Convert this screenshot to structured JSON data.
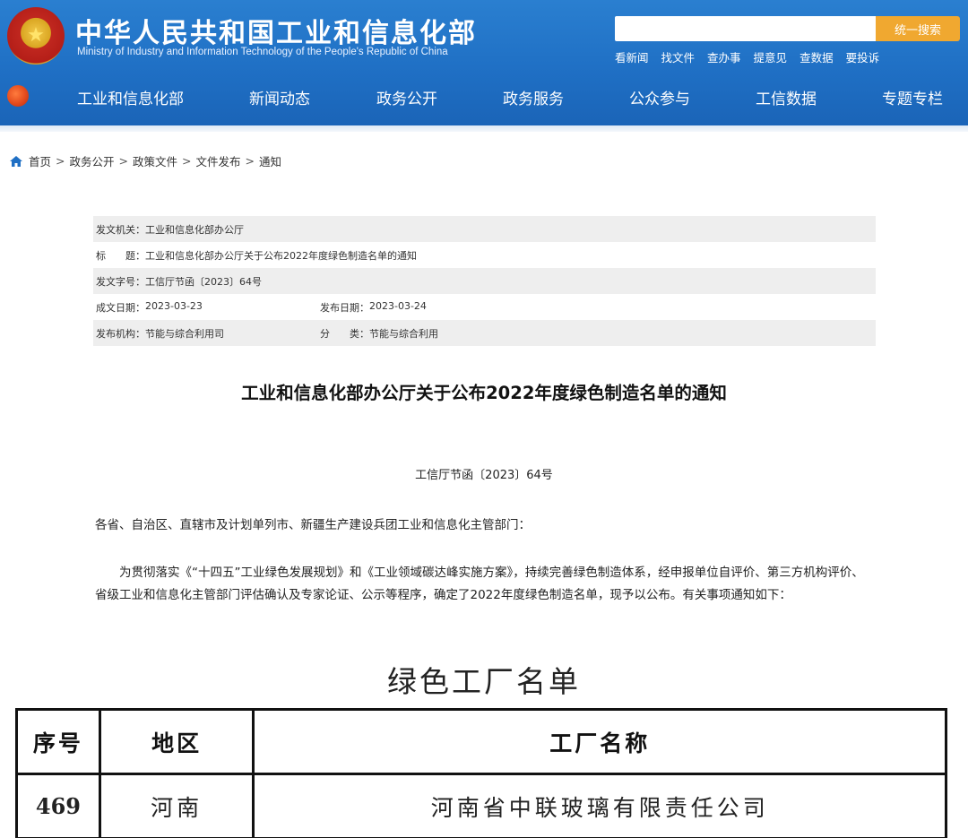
{
  "header": {
    "title_cn": "中华人民共和国工业和信息化部",
    "title_en": "Ministry of Industry and Information Technology of the People's Republic of China",
    "search": {
      "placeholder": "",
      "button_label": "统一搜索"
    },
    "quick_links": [
      "看新闻",
      "找文件",
      "查办事",
      "提意见",
      "查数据",
      "要投诉"
    ]
  },
  "nav": {
    "items": [
      "工业和信息化部",
      "新闻动态",
      "政务公开",
      "政务服务",
      "公众参与",
      "工信数据",
      "专题专栏"
    ]
  },
  "breadcrumb": [
    "首页",
    "政务公开",
    "政策文件",
    "文件发布",
    "通知"
  ],
  "meta": {
    "issuer_label": "发文机关：",
    "issuer": "工业和信息化部办公厅",
    "title_label": "标　　题：",
    "title": "工业和信息化部办公厅关于公布2022年度绿色制造名单的通知",
    "doc_no_label": "发文字号：",
    "doc_no": "工信厅节函〔2023〕64号",
    "written_label": "成文日期：",
    "written_date": "2023-03-23",
    "published_label": "发布日期：",
    "published_date": "2023-03-24",
    "org_label": "发布机构：",
    "org": "节能与综合利用司",
    "category_label": "分　　类：",
    "category": "节能与综合利用"
  },
  "article": {
    "title": "工业和信息化部办公厅关于公布2022年度绿色制造名单的通知",
    "doc_number": "工信厅节函〔2023〕64号",
    "addressee": "各省、自治区、直辖市及计划单列市、新疆生产建设兵团工业和信息化主管部门：",
    "paragraph": "为贯彻落实《“十四五”工业绿色发展规划》和《工业领域碳达峰实施方案》，持续完善绿色制造体系，经申报单位自评价、第三方机构评价、省级工业和信息化主管部门评估确认及专家论证、公示等程序，确定了2022年度绿色制造名单，现予以公布。有关事项通知如下："
  },
  "factory_list": {
    "title": "绿色工厂名单",
    "columns": [
      "序号",
      "地区",
      "工厂名称"
    ],
    "rows": [
      {
        "no": "469",
        "region": "河南",
        "name": "河南省中联玻璃有限责任公司"
      }
    ]
  },
  "colors": {
    "header_blue": "#1f6fc4",
    "search_button": "#f0a830",
    "meta_row_gray": "#eeeeee"
  }
}
